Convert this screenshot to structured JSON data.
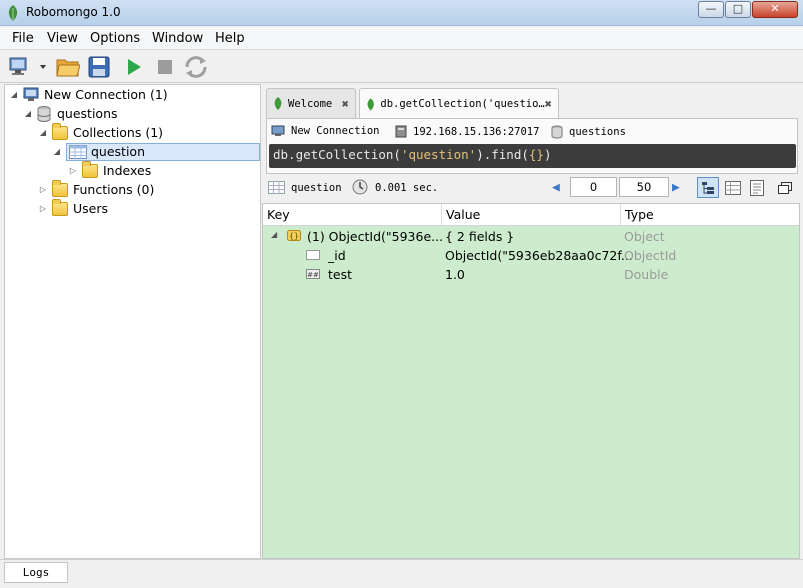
{
  "window": {
    "title": "Robomongo 1.0"
  },
  "menu": [
    "File",
    "View",
    "Options",
    "Window",
    "Help"
  ],
  "tree": {
    "connection": "New Connection (1)",
    "database": "questions",
    "collections": "Collections (1)",
    "collection": "question",
    "indexes": "Indexes",
    "functions": "Functions (0)",
    "users": "Users"
  },
  "tabs": {
    "welcome": "Welcome",
    "query": "db.getCollection('questio…"
  },
  "query_info": {
    "connection": "New Connection",
    "host": "192.168.15.136:27017",
    "database": "questions"
  },
  "editor": {
    "prefix": "db.getCollection(",
    "arg": "'question'",
    "mid": ").find(",
    "braces": "{}",
    "suffix": ")"
  },
  "results_bar": {
    "collection": "question",
    "time": "0.001 sec.",
    "skip": "0",
    "limit": "50"
  },
  "results": {
    "columns": [
      "Key",
      "Value",
      "Type"
    ],
    "rows": [
      {
        "key": "(1) ObjectId(\"5936e...",
        "value": "{ 2 fields }",
        "type": "Object"
      },
      {
        "key": "_id",
        "value": "ObjectId(\"5936eb28aa0c72f...",
        "type": "ObjectId"
      },
      {
        "key": "test",
        "value": "1.0",
        "type": "Double"
      }
    ]
  },
  "statusbar": {
    "logs": "Logs"
  },
  "colors": {
    "result_bg": "#cdeccd",
    "editor_bg": "#3c3c3c",
    "string": "#e6c07b"
  }
}
